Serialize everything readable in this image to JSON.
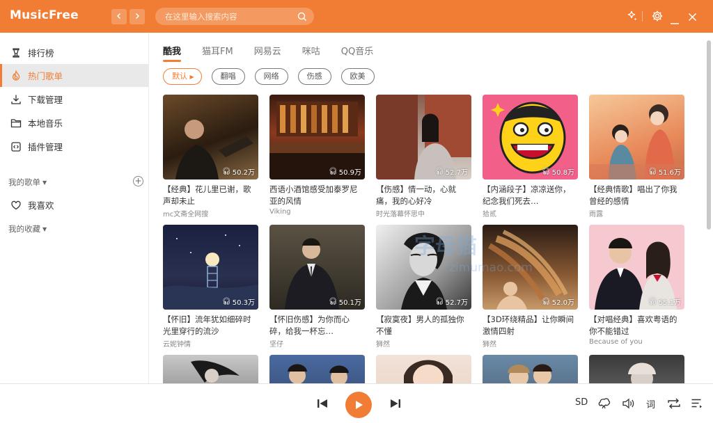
{
  "app": {
    "name": "MusicFree"
  },
  "search": {
    "placeholder": "在这里输入搜索内容"
  },
  "sidebar": {
    "items": [
      {
        "label": "排行榜"
      },
      {
        "label": "热门歌单"
      },
      {
        "label": "下载管理"
      },
      {
        "label": "本地音乐"
      },
      {
        "label": "插件管理"
      }
    ],
    "my_playlists": "我的歌单",
    "favorites": "我喜欢",
    "my_collection": "我的收藏"
  },
  "tabs": [
    {
      "label": "酷我"
    },
    {
      "label": "猫耳FM"
    },
    {
      "label": "网易云"
    },
    {
      "label": "咪咕"
    },
    {
      "label": "QQ音乐"
    }
  ],
  "chips": [
    {
      "label": "默认"
    },
    {
      "label": "翻唱"
    },
    {
      "label": "网络"
    },
    {
      "label": "伤感"
    },
    {
      "label": "欧美"
    }
  ],
  "cards": [
    {
      "count": "50.2万",
      "title": "【经典】花儿里已谢，歌声却未止",
      "author": "mc文斋全网搜"
    },
    {
      "count": "50.9万",
      "title": "西语小酒馆感受加泰罗尼亚的风情",
      "author": "Viking"
    },
    {
      "count": "52.7万",
      "title": "【伤感】情一动，心就痛，我的心好冷",
      "author": "时光落幕怀思中"
    },
    {
      "count": "50.8万",
      "title": "【内涵段子】凉凉送你，纪念我们死去…",
      "author": "拾贰"
    },
    {
      "count": "51.6万",
      "title": "【经典情歌】唱出了你我曾经的感情",
      "author": "雨露"
    },
    {
      "count": "50.3万",
      "title": "【怀旧】流年犹如细碎时光里穿行的流沙",
      "author": "云妮钟情"
    },
    {
      "count": "50.1万",
      "title": "【怀旧伤感】为你而心碎，给我一杯忘…",
      "author": "坚仔"
    },
    {
      "count": "52.7万",
      "title": "【寂寞夜】男人的孤独你不懂",
      "author": "狮然"
    },
    {
      "count": "52.0万",
      "title": "【3D环绕精品】让你瞬间激情四射",
      "author": "狮然"
    },
    {
      "count": "55.1万",
      "title": "【对唱经典】喜欢粤语的你不能错过",
      "author": "Because of you"
    }
  ],
  "player": {
    "quality": "SD",
    "lyrics": "词"
  },
  "watermark": {
    "text": "字母猫",
    "url": "zimumao.com"
  },
  "colors": {
    "accent": "#f17d34"
  }
}
